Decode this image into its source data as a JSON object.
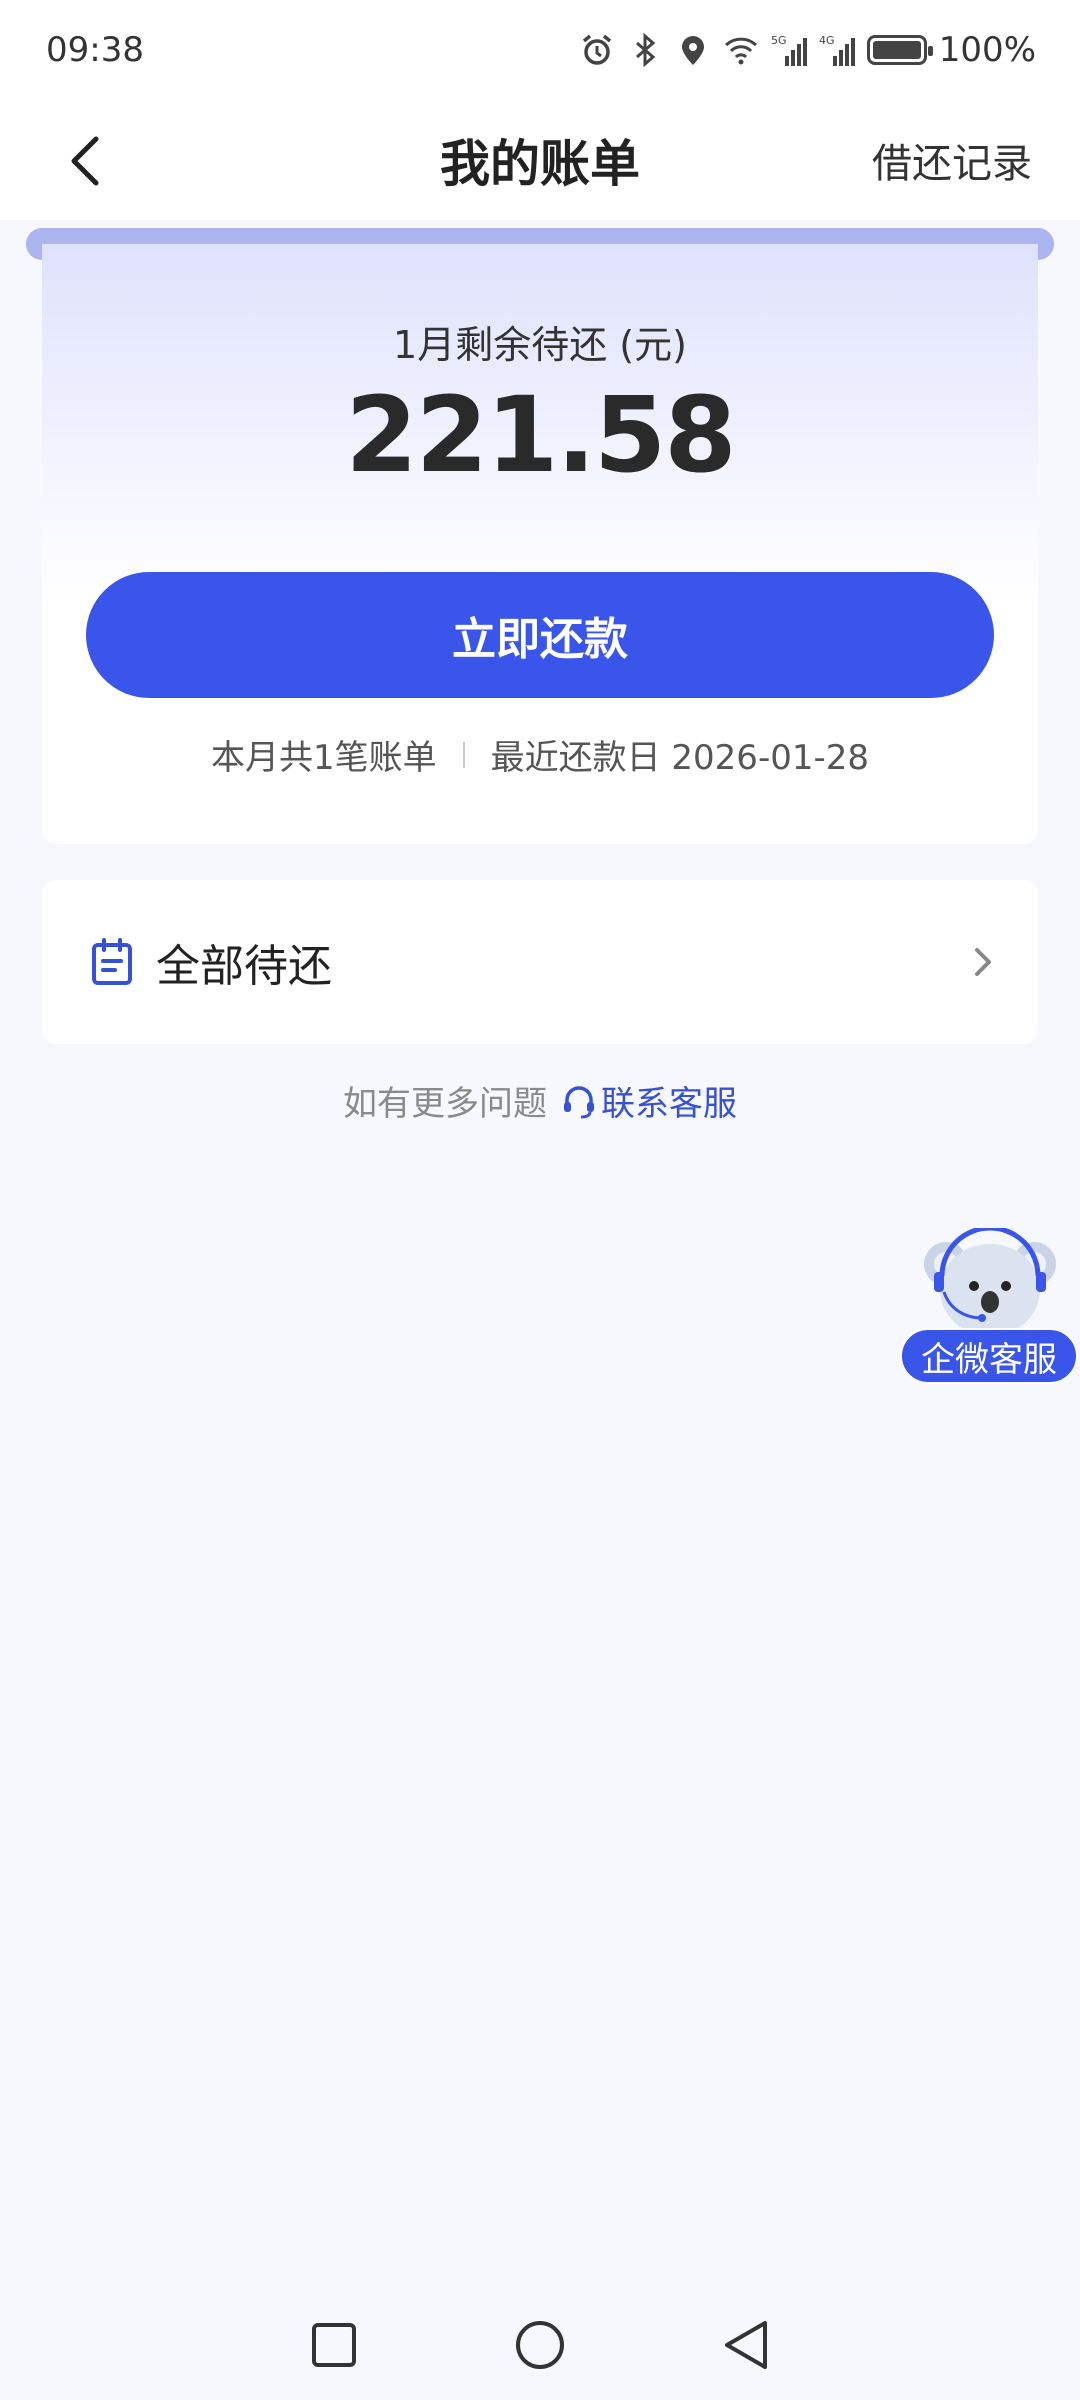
{
  "status_bar": {
    "time": "09:38",
    "battery": "100%",
    "icons": [
      "alarm-icon",
      "bluetooth-icon",
      "location-icon",
      "wifi-icon",
      "signal-5g-icon",
      "signal-4g-icon",
      "battery-icon"
    ]
  },
  "navbar": {
    "title": "我的账单",
    "right_link": "借还记录"
  },
  "summary": {
    "label": "1月剩余待还 (元)",
    "amount": "221.58",
    "pay_button": "立即还款",
    "bill_count": "本月共1笔账单",
    "due_date": "最近还款日 2026-01-28"
  },
  "pending": {
    "label": "全部待还"
  },
  "help": {
    "text": "如有更多问题",
    "link": "联系客服"
  },
  "floating_service": {
    "label": "企微客服"
  },
  "colors": {
    "primary": "#3a55ea",
    "link": "#3650d6",
    "background": "#f7f8fd"
  }
}
